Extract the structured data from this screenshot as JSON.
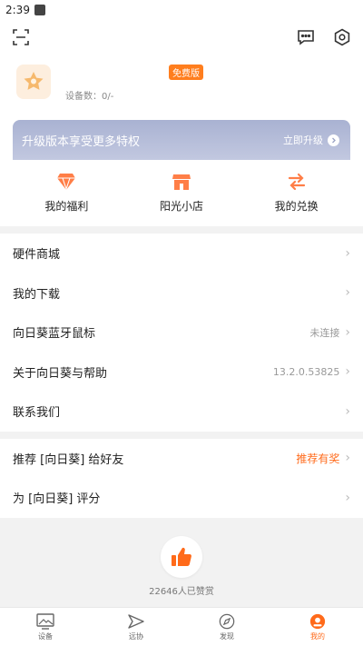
{
  "status": {
    "time": "2:39"
  },
  "profile": {
    "badge": "免费版",
    "device_count": "设备数：0/-"
  },
  "upgrade": {
    "text": "升级版本享受更多特权",
    "link": "立即升级"
  },
  "quick": [
    {
      "label": "我的福利",
      "icon": "gem-icon"
    },
    {
      "label": "阳光小店",
      "icon": "shop-icon"
    },
    {
      "label": "我的兑换",
      "icon": "exchange-icon"
    }
  ],
  "menu1": [
    {
      "label": "硬件商城",
      "value": ""
    },
    {
      "label": "我的下载",
      "value": ""
    },
    {
      "label": "向日葵蓝牙鼠标",
      "value": "未连接"
    },
    {
      "label": "关于向日葵与帮助",
      "value": "13.2.0.53825"
    },
    {
      "label": "联系我们",
      "value": ""
    }
  ],
  "menu2": [
    {
      "label": "推荐 [向日葵] 给好友",
      "value": "推荐有奖"
    },
    {
      "label": "为 [向日葵] 评分",
      "value": ""
    }
  ],
  "likes": {
    "text": "22646人已赞赏"
  },
  "tabs": [
    {
      "label": "设备",
      "icon": "device-icon"
    },
    {
      "label": "远协",
      "icon": "remote-assist-icon"
    },
    {
      "label": "发现",
      "icon": "compass-icon"
    },
    {
      "label": "我的",
      "icon": "profile-icon"
    }
  ],
  "colors": {
    "accent": "#ff6a1a",
    "badge": "#ff7e1e",
    "upgrade_bg": "#a9b2d2"
  }
}
